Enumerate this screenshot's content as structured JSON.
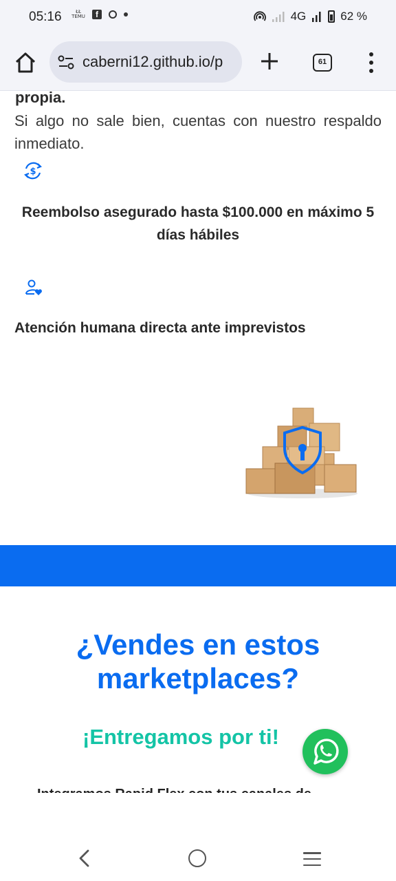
{
  "status_bar": {
    "time": "05:16",
    "temu_label": "TEMU",
    "network": "4G",
    "battery": "62 %"
  },
  "browser": {
    "url": "caberni12.github.io/p",
    "tab_count": "61"
  },
  "content": {
    "truncated_heading": "propia.",
    "description": "Si algo no sale bien, cuentas con nuestro respaldo inmediato.",
    "feature_refund": "Reembolso asegurado hasta $100.000 en máximo 5 días hábiles",
    "feature_support": "Atención humana directa ante imprevistos",
    "marketplaces_heading": "¿Vendes en estos marketplaces?",
    "marketplaces_subheading": "¡Entregamos por ti!",
    "cut_text": "Integramos Rapid Flex con tus canales de"
  },
  "colors": {
    "brand_blue": "#0a6cf0",
    "accent_teal": "#14c4a6",
    "whatsapp_green": "#21c05c"
  },
  "icons": {
    "refund": "refund-cycle-icon",
    "support": "person-heart-icon",
    "boxes": "secure-boxes-illustration",
    "whatsapp": "whatsapp-icon"
  }
}
